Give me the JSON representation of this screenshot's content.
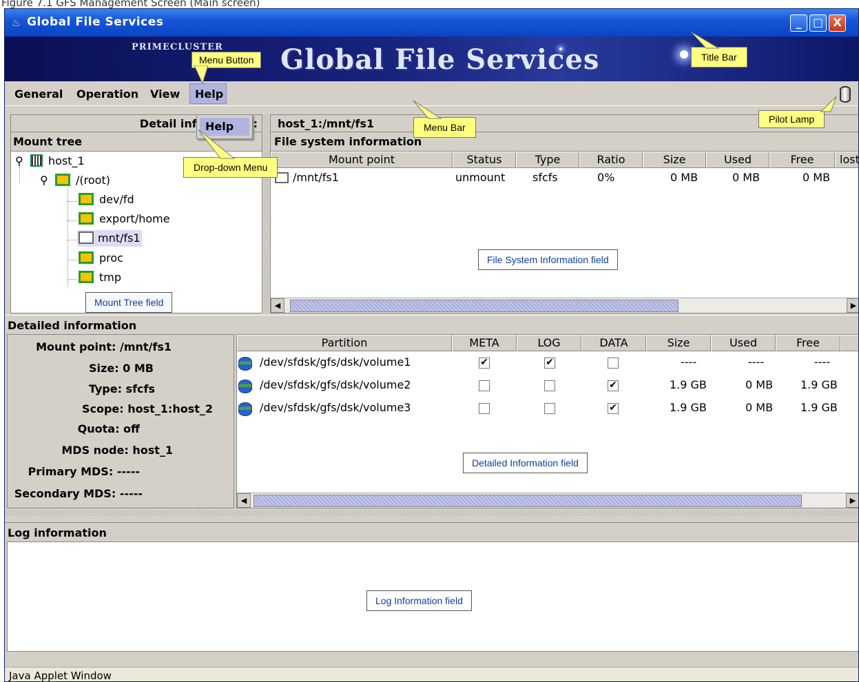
{
  "caption": "Figure 7.1 GFS Management Screen (Main screen)",
  "window": {
    "title": "Global File Services",
    "buttons": {
      "minimize": "_",
      "maximize": "□",
      "close": "X"
    }
  },
  "banner": {
    "brand": "PRIMECLUSTER",
    "title": "Global File Services"
  },
  "menubar": {
    "items": [
      "General",
      "Operation",
      "View",
      "Help"
    ]
  },
  "dropdown": {
    "items": [
      "Help"
    ]
  },
  "left_panel": {
    "detail_header": "Detail information: ",
    "mount_tree_header": "Mount tree",
    "tree": {
      "host": "host_1",
      "root": "/(root)",
      "children": [
        "dev/fd",
        "export/home",
        "mnt/fs1",
        "proc",
        "tmp"
      ]
    }
  },
  "right_panel": {
    "path": "host_1:/mnt/fs1",
    "fs_header": "File system information",
    "columns": [
      "Mount point",
      "Status",
      "Type",
      "Ratio",
      "Size",
      "Used",
      "Free",
      "lost"
    ],
    "rows": [
      {
        "mount_point": "/mnt/fs1",
        "status": "unmount",
        "type": "sfcfs",
        "ratio": "0%",
        "size": "0 MB",
        "used": "0 MB",
        "free": "0 MB"
      }
    ]
  },
  "detailed": {
    "header": "Detailed information",
    "lines": [
      "Mount point: /mnt/fs1",
      "Size: 0 MB",
      "Type: sfcfs",
      "Scope: host_1:host_2",
      "Quota: off",
      "MDS node: host_1",
      "Primary MDS: -----",
      "Secondary MDS: -----"
    ],
    "columns": [
      "Partition",
      "META",
      "LOG",
      "DATA",
      "Size",
      "Used",
      "Free"
    ],
    "rows": [
      {
        "partition": "/dev/sfdsk/gfs/dsk/volume1",
        "meta": true,
        "log": true,
        "data": false,
        "size": "----",
        "used": "----",
        "free": "----"
      },
      {
        "partition": "/dev/sfdsk/gfs/dsk/volume2",
        "meta": false,
        "log": false,
        "data": true,
        "size": "1.9 GB",
        "used": "0 MB",
        "free": "1.9 GB"
      },
      {
        "partition": "/dev/sfdsk/gfs/dsk/volume3",
        "meta": false,
        "log": false,
        "data": true,
        "size": "1.9 GB",
        "used": "0 MB",
        "free": "1.9 GB"
      }
    ]
  },
  "log": {
    "header": "Log information"
  },
  "statusbar": {
    "text": "Java Applet Window"
  },
  "callouts": {
    "menu_button": "Menu Button",
    "title_bar": "Title Bar",
    "menu_bar": "Menu Bar",
    "pilot_lamp": "Pilot Lamp",
    "dropdown_menu": "Drop-down Menu",
    "mount_tree_field": "Mount Tree field",
    "fs_info_field": "File System Information field",
    "detailed_info_field": "Detailed Information field",
    "log_info_field": "Log Information field"
  },
  "colors": {
    "titlebar": "#1656d8",
    "banner": "#18237e",
    "menu_highlight": "#b0b5e0",
    "callout_yellow": "#ffff80",
    "callout_text_blue": "#0b3ca8"
  }
}
